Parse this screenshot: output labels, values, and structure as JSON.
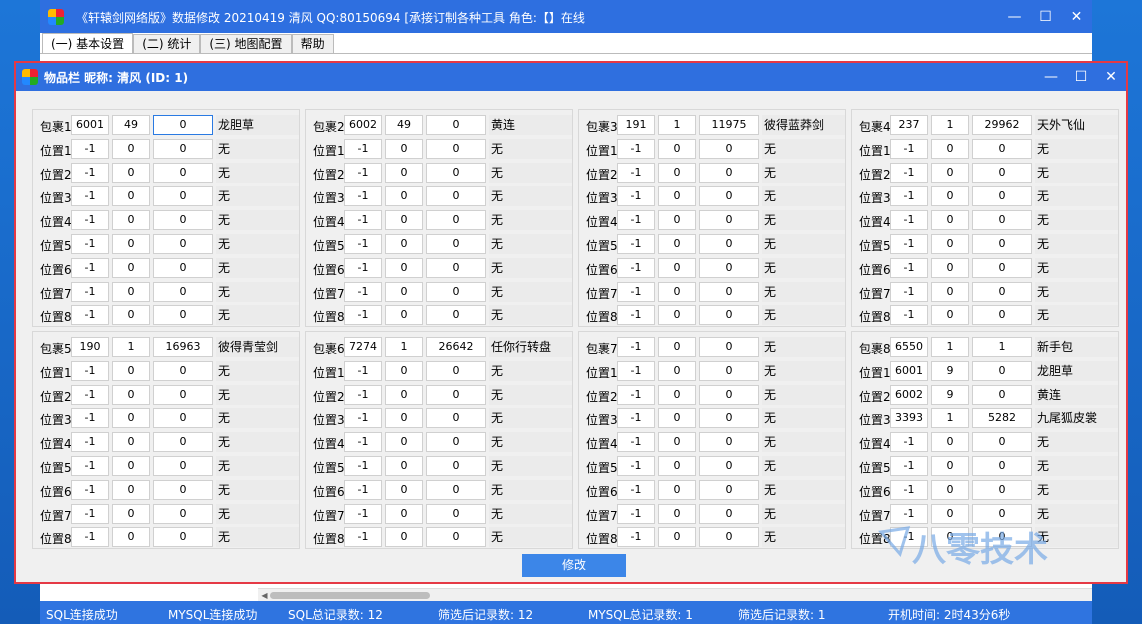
{
  "main_window": {
    "title": "《轩辕剑网络版》数据修改   20210419   清风   QQ:80150694    [承接订制各种工具    角色:【】在线",
    "tabs": [
      {
        "label": "(一) 基本设置",
        "active": true
      },
      {
        "label": "(二) 统计",
        "active": false
      },
      {
        "label": "(三) 地图配置",
        "active": false
      },
      {
        "label": "帮助",
        "active": false
      }
    ],
    "status": {
      "sql": "SQL连接成功",
      "mysql": "MYSQL连接成功",
      "sql_total": "SQL总记录数: 12",
      "filter1": "筛选后记录数: 12",
      "mysql_total": "MYSQL总记录数: 1",
      "filter2": "筛选后记录数: 1",
      "uptime": "开机时间: 2时43分6秒"
    }
  },
  "child_window": {
    "title": "物品栏   昵称: 清风 (ID: 1)",
    "modify_label": "修改",
    "panels": [
      {
        "rows": [
          {
            "label": "包裹1",
            "a": "6001",
            "b": "49",
            "c": "0",
            "name": "龙胆草"
          },
          {
            "label": "位置1",
            "a": "-1",
            "b": "0",
            "c": "0",
            "name": "无"
          },
          {
            "label": "位置2",
            "a": "-1",
            "b": "0",
            "c": "0",
            "name": "无"
          },
          {
            "label": "位置3",
            "a": "-1",
            "b": "0",
            "c": "0",
            "name": "无"
          },
          {
            "label": "位置4",
            "a": "-1",
            "b": "0",
            "c": "0",
            "name": "无"
          },
          {
            "label": "位置5",
            "a": "-1",
            "b": "0",
            "c": "0",
            "name": "无"
          },
          {
            "label": "位置6",
            "a": "-1",
            "b": "0",
            "c": "0",
            "name": "无"
          },
          {
            "label": "位置7",
            "a": "-1",
            "b": "0",
            "c": "0",
            "name": "无"
          },
          {
            "label": "位置8",
            "a": "-1",
            "b": "0",
            "c": "0",
            "name": "无"
          }
        ]
      },
      {
        "rows": [
          {
            "label": "包裹2",
            "a": "6002",
            "b": "49",
            "c": "0",
            "name": "黄连"
          },
          {
            "label": "位置1",
            "a": "-1",
            "b": "0",
            "c": "0",
            "name": "无"
          },
          {
            "label": "位置2",
            "a": "-1",
            "b": "0",
            "c": "0",
            "name": "无"
          },
          {
            "label": "位置3",
            "a": "-1",
            "b": "0",
            "c": "0",
            "name": "无"
          },
          {
            "label": "位置4",
            "a": "-1",
            "b": "0",
            "c": "0",
            "name": "无"
          },
          {
            "label": "位置5",
            "a": "-1",
            "b": "0",
            "c": "0",
            "name": "无"
          },
          {
            "label": "位置6",
            "a": "-1",
            "b": "0",
            "c": "0",
            "name": "无"
          },
          {
            "label": "位置7",
            "a": "-1",
            "b": "0",
            "c": "0",
            "name": "无"
          },
          {
            "label": "位置8",
            "a": "-1",
            "b": "0",
            "c": "0",
            "name": "无"
          }
        ]
      },
      {
        "rows": [
          {
            "label": "包裹3",
            "a": "191",
            "b": "1",
            "c": "11975",
            "name": "彼得蓝莽剑"
          },
          {
            "label": "位置1",
            "a": "-1",
            "b": "0",
            "c": "0",
            "name": "无"
          },
          {
            "label": "位置2",
            "a": "-1",
            "b": "0",
            "c": "0",
            "name": "无"
          },
          {
            "label": "位置3",
            "a": "-1",
            "b": "0",
            "c": "0",
            "name": "无"
          },
          {
            "label": "位置4",
            "a": "-1",
            "b": "0",
            "c": "0",
            "name": "无"
          },
          {
            "label": "位置5",
            "a": "-1",
            "b": "0",
            "c": "0",
            "name": "无"
          },
          {
            "label": "位置6",
            "a": "-1",
            "b": "0",
            "c": "0",
            "name": "无"
          },
          {
            "label": "位置7",
            "a": "-1",
            "b": "0",
            "c": "0",
            "name": "无"
          },
          {
            "label": "位置8",
            "a": "-1",
            "b": "0",
            "c": "0",
            "name": "无"
          }
        ]
      },
      {
        "rows": [
          {
            "label": "包裹4",
            "a": "237",
            "b": "1",
            "c": "29962",
            "name": "天外飞仙"
          },
          {
            "label": "位置1",
            "a": "-1",
            "b": "0",
            "c": "0",
            "name": "无"
          },
          {
            "label": "位置2",
            "a": "-1",
            "b": "0",
            "c": "0",
            "name": "无"
          },
          {
            "label": "位置3",
            "a": "-1",
            "b": "0",
            "c": "0",
            "name": "无"
          },
          {
            "label": "位置4",
            "a": "-1",
            "b": "0",
            "c": "0",
            "name": "无"
          },
          {
            "label": "位置5",
            "a": "-1",
            "b": "0",
            "c": "0",
            "name": "无"
          },
          {
            "label": "位置6",
            "a": "-1",
            "b": "0",
            "c": "0",
            "name": "无"
          },
          {
            "label": "位置7",
            "a": "-1",
            "b": "0",
            "c": "0",
            "name": "无"
          },
          {
            "label": "位置8",
            "a": "-1",
            "b": "0",
            "c": "0",
            "name": "无"
          }
        ]
      },
      {
        "rows": [
          {
            "label": "包裹5",
            "a": "190",
            "b": "1",
            "c": "16963",
            "name": "彼得青莹剑"
          },
          {
            "label": "位置1",
            "a": "-1",
            "b": "0",
            "c": "0",
            "name": "无"
          },
          {
            "label": "位置2",
            "a": "-1",
            "b": "0",
            "c": "0",
            "name": "无"
          },
          {
            "label": "位置3",
            "a": "-1",
            "b": "0",
            "c": "0",
            "name": "无"
          },
          {
            "label": "位置4",
            "a": "-1",
            "b": "0",
            "c": "0",
            "name": "无"
          },
          {
            "label": "位置5",
            "a": "-1",
            "b": "0",
            "c": "0",
            "name": "无"
          },
          {
            "label": "位置6",
            "a": "-1",
            "b": "0",
            "c": "0",
            "name": "无"
          },
          {
            "label": "位置7",
            "a": "-1",
            "b": "0",
            "c": "0",
            "name": "无"
          },
          {
            "label": "位置8",
            "a": "-1",
            "b": "0",
            "c": "0",
            "name": "无"
          }
        ]
      },
      {
        "rows": [
          {
            "label": "包裹6",
            "a": "7274",
            "b": "1",
            "c": "26642",
            "name": "任你行转盘"
          },
          {
            "label": "位置1",
            "a": "-1",
            "b": "0",
            "c": "0",
            "name": "无"
          },
          {
            "label": "位置2",
            "a": "-1",
            "b": "0",
            "c": "0",
            "name": "无"
          },
          {
            "label": "位置3",
            "a": "-1",
            "b": "0",
            "c": "0",
            "name": "无"
          },
          {
            "label": "位置4",
            "a": "-1",
            "b": "0",
            "c": "0",
            "name": "无"
          },
          {
            "label": "位置5",
            "a": "-1",
            "b": "0",
            "c": "0",
            "name": "无"
          },
          {
            "label": "位置6",
            "a": "-1",
            "b": "0",
            "c": "0",
            "name": "无"
          },
          {
            "label": "位置7",
            "a": "-1",
            "b": "0",
            "c": "0",
            "name": "无"
          },
          {
            "label": "位置8",
            "a": "-1",
            "b": "0",
            "c": "0",
            "name": "无"
          }
        ]
      },
      {
        "rows": [
          {
            "label": "包裹7",
            "a": "-1",
            "b": "0",
            "c": "0",
            "name": "无"
          },
          {
            "label": "位置1",
            "a": "-1",
            "b": "0",
            "c": "0",
            "name": "无"
          },
          {
            "label": "位置2",
            "a": "-1",
            "b": "0",
            "c": "0",
            "name": "无"
          },
          {
            "label": "位置3",
            "a": "-1",
            "b": "0",
            "c": "0",
            "name": "无"
          },
          {
            "label": "位置4",
            "a": "-1",
            "b": "0",
            "c": "0",
            "name": "无"
          },
          {
            "label": "位置5",
            "a": "-1",
            "b": "0",
            "c": "0",
            "name": "无"
          },
          {
            "label": "位置6",
            "a": "-1",
            "b": "0",
            "c": "0",
            "name": "无"
          },
          {
            "label": "位置7",
            "a": "-1",
            "b": "0",
            "c": "0",
            "name": "无"
          },
          {
            "label": "位置8",
            "a": "-1",
            "b": "0",
            "c": "0",
            "name": "无"
          }
        ]
      },
      {
        "rows": [
          {
            "label": "包裹8",
            "a": "6550",
            "b": "1",
            "c": "1",
            "name": "新手包"
          },
          {
            "label": "位置1",
            "a": "6001",
            "b": "9",
            "c": "0",
            "name": "龙胆草"
          },
          {
            "label": "位置2",
            "a": "6002",
            "b": "9",
            "c": "0",
            "name": "黄连"
          },
          {
            "label": "位置3",
            "a": "3393",
            "b": "1",
            "c": "5282",
            "name": "九尾狐皮裳"
          },
          {
            "label": "位置4",
            "a": "-1",
            "b": "0",
            "c": "0",
            "name": "无"
          },
          {
            "label": "位置5",
            "a": "-1",
            "b": "0",
            "c": "0",
            "name": "无"
          },
          {
            "label": "位置6",
            "a": "-1",
            "b": "0",
            "c": "0",
            "name": "无"
          },
          {
            "label": "位置7",
            "a": "-1",
            "b": "0",
            "c": "0",
            "name": "无"
          },
          {
            "label": "位置8",
            "a": "-1",
            "b": "0",
            "c": "0",
            "name": "无"
          }
        ]
      }
    ]
  },
  "watermark": "八零技术",
  "colors": {
    "titlebar": "#2e6fe0",
    "statusbar": "#2f74e0",
    "child_border": "#e53945",
    "button": "#3c86e8"
  }
}
